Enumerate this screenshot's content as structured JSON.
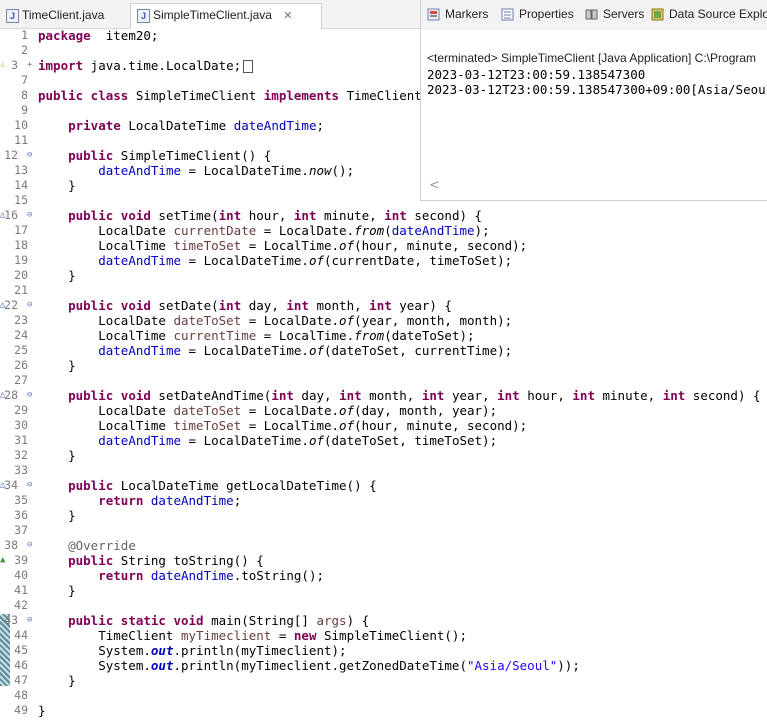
{
  "editor_tabs": [
    {
      "label": "TimeClient.java"
    },
    {
      "label": "SimpleTimeClient.java",
      "close": "✕"
    }
  ],
  "console": {
    "tabs": [
      {
        "label": "Markers",
        "icon": "markers-icon"
      },
      {
        "label": "Properties",
        "icon": "properties-icon"
      },
      {
        "label": "Servers",
        "icon": "servers-icon"
      },
      {
        "label": "Data Source Explo",
        "icon": "data-source-icon"
      }
    ],
    "title": "<terminated> SimpleTimeClient [Java Application] C:\\Program",
    "output": [
      "2023-03-12T23:00:59.138547300",
      "2023-03-12T23:00:59.138547300+09:00[Asia/Seoul]"
    ],
    "scroll_left": "<"
  },
  "code_lines": [
    {
      "n": "1",
      "tokens": [
        [
          "kw",
          "package"
        ],
        [
          "",
          "  item20;"
        ]
      ]
    },
    {
      "n": "2",
      "tokens": []
    },
    {
      "n": "3",
      "fold": "+",
      "marker": "warn",
      "tokens": [
        [
          "kw",
          "import"
        ],
        [
          "",
          " java.time.LocalDate;"
        ],
        [
          "collapsed",
          ""
        ]
      ]
    },
    {
      "n": "7",
      "tokens": []
    },
    {
      "n": "8",
      "tokens": [
        [
          "kw",
          "public class"
        ],
        [
          "",
          " SimpleTimeClient "
        ],
        [
          "kw",
          "implements"
        ],
        [
          "",
          " TimeClient {"
        ]
      ]
    },
    {
      "n": "9",
      "tokens": []
    },
    {
      "n": "10",
      "tokens": [
        [
          "",
          "    "
        ],
        [
          "kw",
          "private"
        ],
        [
          "",
          " LocalDateTime "
        ],
        [
          "fld",
          "dateAndTime"
        ],
        [
          "",
          ";"
        ]
      ]
    },
    {
      "n": "11",
      "tokens": []
    },
    {
      "n": "12",
      "fold": "⊖",
      "tokens": [
        [
          "",
          "    "
        ],
        [
          "kw",
          "public"
        ],
        [
          "",
          " SimpleTimeClient() {"
        ]
      ]
    },
    {
      "n": "13",
      "tokens": [
        [
          "",
          "        "
        ],
        [
          "fld",
          "dateAndTime"
        ],
        [
          "",
          " = LocalDateTime."
        ],
        [
          "italic",
          "now"
        ],
        [
          "",
          "();"
        ]
      ]
    },
    {
      "n": "14",
      "tokens": [
        [
          "",
          "    }"
        ]
      ]
    },
    {
      "n": "15",
      "tokens": []
    },
    {
      "n": "16",
      "fold": "⊖",
      "marker": "impl",
      "tokens": [
        [
          "",
          "    "
        ],
        [
          "kw",
          "public void"
        ],
        [
          "",
          " setTime("
        ],
        [
          "kw",
          "int"
        ],
        [
          "",
          " hour, "
        ],
        [
          "kw",
          "int"
        ],
        [
          "",
          " minute, "
        ],
        [
          "kw",
          "int"
        ],
        [
          "",
          " second) {"
        ]
      ]
    },
    {
      "n": "17",
      "tokens": [
        [
          "",
          "        LocalDate "
        ],
        [
          "varv",
          "currentDate"
        ],
        [
          "",
          " = LocalDate."
        ],
        [
          "italic",
          "from"
        ],
        [
          "",
          "("
        ],
        [
          "fld",
          "dateAndTime"
        ],
        [
          "",
          ");"
        ]
      ]
    },
    {
      "n": "18",
      "tokens": [
        [
          "",
          "        LocalTime "
        ],
        [
          "varv",
          "timeToSet"
        ],
        [
          "",
          " = LocalTime."
        ],
        [
          "italic",
          "of"
        ],
        [
          "",
          "(hour, minute, second);"
        ]
      ]
    },
    {
      "n": "19",
      "tokens": [
        [
          "",
          "        "
        ],
        [
          "fld",
          "dateAndTime"
        ],
        [
          "",
          " = LocalDateTime."
        ],
        [
          "italic",
          "of"
        ],
        [
          "",
          "(currentDate, timeToSet);"
        ]
      ]
    },
    {
      "n": "20",
      "tokens": [
        [
          "",
          "    }"
        ]
      ]
    },
    {
      "n": "21",
      "tokens": []
    },
    {
      "n": "22",
      "fold": "⊖",
      "marker": "impl",
      "tokens": [
        [
          "",
          "    "
        ],
        [
          "kw",
          "public void"
        ],
        [
          "",
          " setDate("
        ],
        [
          "kw",
          "int"
        ],
        [
          "",
          " day, "
        ],
        [
          "kw",
          "int"
        ],
        [
          "",
          " month, "
        ],
        [
          "kw",
          "int"
        ],
        [
          "",
          " year) {"
        ]
      ]
    },
    {
      "n": "23",
      "tokens": [
        [
          "",
          "        LocalDate "
        ],
        [
          "varv",
          "dateToSet"
        ],
        [
          "",
          " = LocalDate."
        ],
        [
          "italic",
          "of"
        ],
        [
          "",
          "(year, month, month);"
        ]
      ]
    },
    {
      "n": "24",
      "tokens": [
        [
          "",
          "        LocalTime "
        ],
        [
          "varv",
          "currentTime"
        ],
        [
          "",
          " = LocalTime."
        ],
        [
          "italic",
          "from"
        ],
        [
          "",
          "(dateToSet);"
        ]
      ]
    },
    {
      "n": "25",
      "tokens": [
        [
          "",
          "        "
        ],
        [
          "fld",
          "dateAndTime"
        ],
        [
          "",
          " = LocalDateTime."
        ],
        [
          "italic",
          "of"
        ],
        [
          "",
          "(dateToSet, currentTime);"
        ]
      ]
    },
    {
      "n": "26",
      "tokens": [
        [
          "",
          "    }"
        ]
      ]
    },
    {
      "n": "27",
      "tokens": []
    },
    {
      "n": "28",
      "fold": "⊖",
      "marker": "impl",
      "tokens": [
        [
          "",
          "    "
        ],
        [
          "kw",
          "public void"
        ],
        [
          "",
          " setDateAndTime("
        ],
        [
          "kw",
          "int"
        ],
        [
          "",
          " day, "
        ],
        [
          "kw",
          "int"
        ],
        [
          "",
          " month, "
        ],
        [
          "kw",
          "int"
        ],
        [
          "",
          " year, "
        ],
        [
          "kw",
          "int"
        ],
        [
          "",
          " hour, "
        ],
        [
          "kw",
          "int"
        ],
        [
          "",
          " minute, "
        ],
        [
          "kw",
          "int"
        ],
        [
          "",
          " second) {"
        ]
      ]
    },
    {
      "n": "29",
      "tokens": [
        [
          "",
          "        LocalDate "
        ],
        [
          "varv",
          "dateToSet"
        ],
        [
          "",
          " = LocalDate."
        ],
        [
          "italic",
          "of"
        ],
        [
          "",
          "(day, month, year);"
        ]
      ]
    },
    {
      "n": "30",
      "tokens": [
        [
          "",
          "        LocalTime "
        ],
        [
          "varv",
          "timeToSet"
        ],
        [
          "",
          " = LocalTime."
        ],
        [
          "italic",
          "of"
        ],
        [
          "",
          "(hour, minute, second);"
        ]
      ]
    },
    {
      "n": "31",
      "tokens": [
        [
          "",
          "        "
        ],
        [
          "fld",
          "dateAndTime"
        ],
        [
          "",
          " = LocalDateTime."
        ],
        [
          "italic",
          "of"
        ],
        [
          "",
          "(dateToSet, timeToSet);"
        ]
      ]
    },
    {
      "n": "32",
      "tokens": [
        [
          "",
          "    }"
        ]
      ]
    },
    {
      "n": "33",
      "tokens": []
    },
    {
      "n": "34",
      "fold": "⊖",
      "marker": "impl",
      "tokens": [
        [
          "",
          "    "
        ],
        [
          "kw",
          "public"
        ],
        [
          "",
          " LocalDateTime getLocalDateTime() {"
        ]
      ]
    },
    {
      "n": "35",
      "tokens": [
        [
          "",
          "        "
        ],
        [
          "kw",
          "return"
        ],
        [
          "",
          " "
        ],
        [
          "fld",
          "dateAndTime"
        ],
        [
          "",
          ";"
        ]
      ]
    },
    {
      "n": "36",
      "tokens": [
        [
          "",
          "    }"
        ]
      ]
    },
    {
      "n": "37",
      "tokens": []
    },
    {
      "n": "38",
      "fold": "⊖",
      "tokens": [
        [
          "",
          "    "
        ],
        [
          "ann",
          "@Override"
        ]
      ]
    },
    {
      "n": "39",
      "marker": "override",
      "tokens": [
        [
          "",
          "    "
        ],
        [
          "kw",
          "public"
        ],
        [
          "",
          " String toString() {"
        ]
      ]
    },
    {
      "n": "40",
      "tokens": [
        [
          "",
          "        "
        ],
        [
          "kw",
          "return"
        ],
        [
          "",
          " "
        ],
        [
          "fld",
          "dateAndTime"
        ],
        [
          "",
          ".toString();"
        ]
      ]
    },
    {
      "n": "41",
      "tokens": [
        [
          "",
          "    }"
        ]
      ]
    },
    {
      "n": "42",
      "tokens": []
    },
    {
      "n": "43",
      "fold": "⊖",
      "tokens": [
        [
          "",
          "    "
        ],
        [
          "kw",
          "public static void"
        ],
        [
          "",
          " main(String[] "
        ],
        [
          "varv",
          "args"
        ],
        [
          "",
          ") {"
        ]
      ]
    },
    {
      "n": "44",
      "tokens": [
        [
          "",
          "        TimeClient "
        ],
        [
          "varv",
          "myTimeclient"
        ],
        [
          "",
          " = "
        ],
        [
          "kw",
          "new"
        ],
        [
          "",
          " SimpleTimeClient();"
        ]
      ]
    },
    {
      "n": "45",
      "tokens": [
        [
          "",
          "        System."
        ],
        [
          "boldit",
          "out"
        ],
        [
          "",
          ".println(myTimeclient);"
        ]
      ]
    },
    {
      "n": "46",
      "tokens": [
        [
          "",
          "        System."
        ],
        [
          "boldit",
          "out"
        ],
        [
          "",
          ".println(myTimeclient.getZonedDateTime("
        ],
        [
          "str",
          "\"Asia/Seoul\""
        ],
        [
          "",
          "));"
        ]
      ]
    },
    {
      "n": "47",
      "tokens": [
        [
          "",
          "    }"
        ]
      ]
    },
    {
      "n": "48",
      "tokens": []
    },
    {
      "n": "49",
      "tokens": [
        [
          "",
          "}"
        ]
      ]
    }
  ]
}
